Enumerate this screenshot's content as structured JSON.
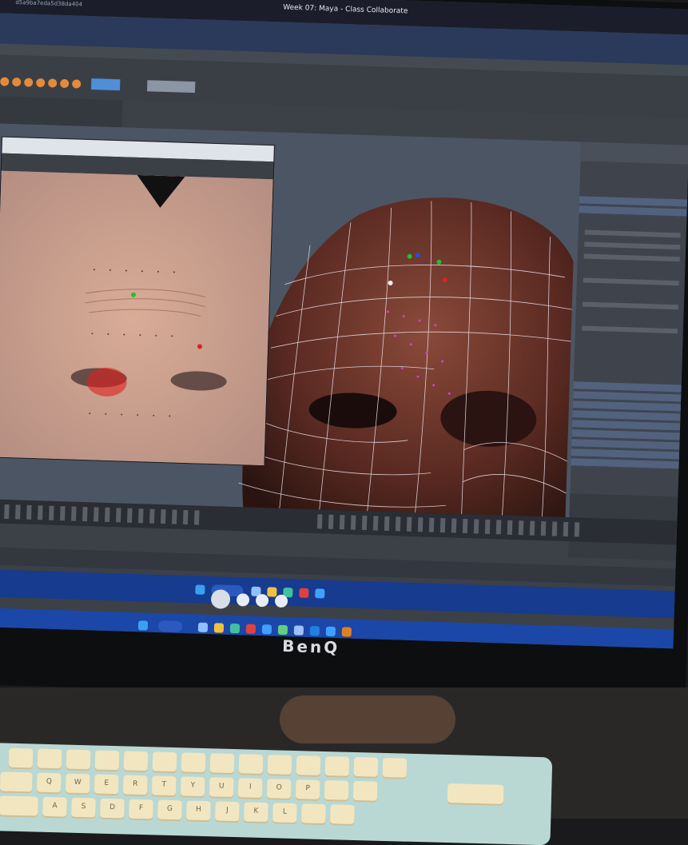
{
  "window": {
    "title": "Week 07: Maya - Class Collaborate",
    "session_id": "d5a9ba7eda5d38da404"
  },
  "monitor": {
    "brand": "BenQ"
  },
  "keyboard": {
    "row1": [
      "Q",
      "W",
      "E",
      "R",
      "T",
      "Y",
      "U",
      "I",
      "O",
      "P"
    ],
    "row2": [
      "A",
      "S",
      "D",
      "F",
      "G",
      "H",
      "J",
      "K",
      "L"
    ]
  },
  "colors": {
    "skin": "#8a4a3a",
    "wireframe": "#f0e6f0",
    "selection_red": "#e02020",
    "taskbar": "#1b47a8",
    "keycap": "#f2e6c0",
    "keyboard_case": "#b9d8d4"
  }
}
